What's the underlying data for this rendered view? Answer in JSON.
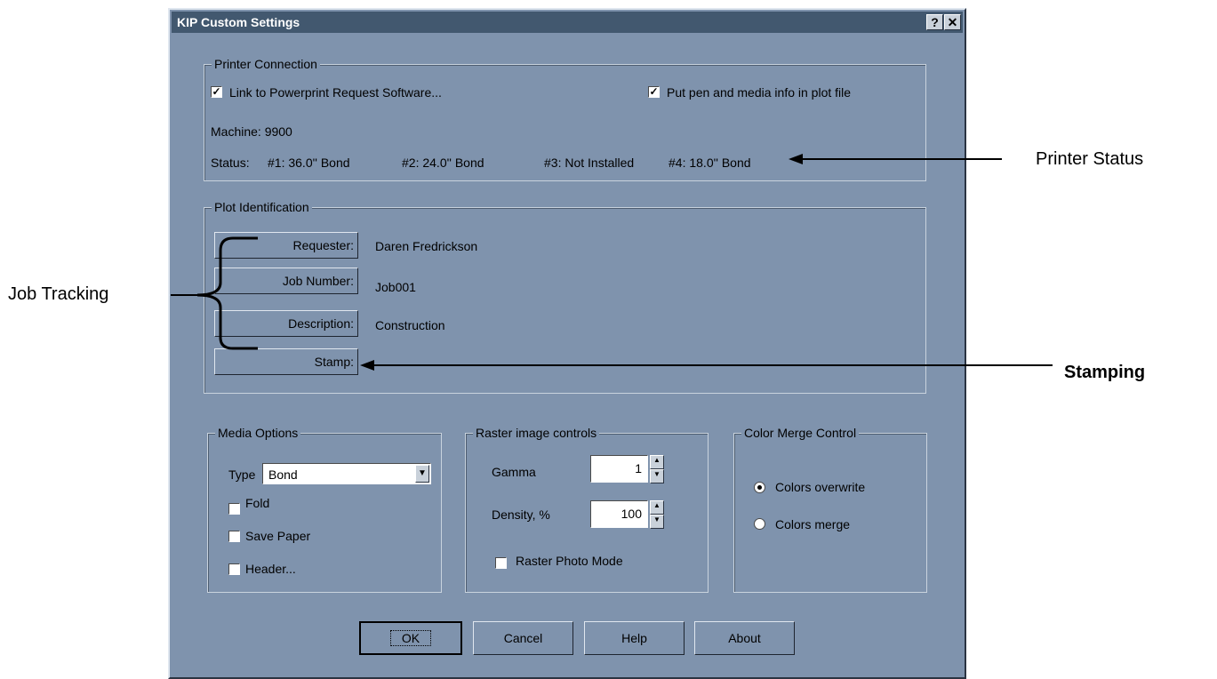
{
  "window": {
    "title": "KIP Custom Settings",
    "help_label": "?",
    "close_label": "✕"
  },
  "printer_connection": {
    "legend": "Printer Connection",
    "link_label": "Link to Powerprint Request Software...",
    "link_checked": true,
    "pen_label": "Put pen and media info in plot file",
    "pen_checked": true,
    "machine": "Machine: 9900",
    "status_label": "Status:",
    "rolls": [
      "#1: 36.0'' Bond",
      "#2: 24.0'' Bond",
      "#3: Not Installed",
      "#4: 18.0'' Bond"
    ]
  },
  "plot_identification": {
    "legend": "Plot Identification",
    "requester_label": "Requester:",
    "requester_value": "Daren Fredrickson",
    "job_label": "Job Number:",
    "job_value": "Job001",
    "description_label": "Description:",
    "description_value": "Construction",
    "stamp_label": "Stamp:"
  },
  "media_options": {
    "legend": "Media Options",
    "type_label": "Type",
    "type_value": "Bond",
    "fold_label": "Fold",
    "fold_checked": false,
    "save_paper_label": "Save Paper",
    "save_paper_checked": false,
    "header_label": "Header...",
    "header_checked": false
  },
  "raster": {
    "legend": "Raster image controls",
    "gamma_label": "Gamma",
    "gamma_value": "1",
    "density_label": "Density, %",
    "density_value": "100",
    "photo_label": "Raster Photo Mode",
    "photo_checked": false
  },
  "color_merge": {
    "legend": "Color Merge Control",
    "overwrite_label": "Colors overwrite",
    "merge_label": "Colors merge",
    "selected": "overwrite"
  },
  "buttons": {
    "ok": "OK",
    "cancel": "Cancel",
    "help": "Help",
    "about": "About"
  },
  "annotations": {
    "printer_status": "Printer Status",
    "job_tracking": "Job Tracking",
    "stamping": "Stamping"
  },
  "colors": {
    "dialog_bg": "#7f93ad",
    "titlebar": "#42586f"
  }
}
